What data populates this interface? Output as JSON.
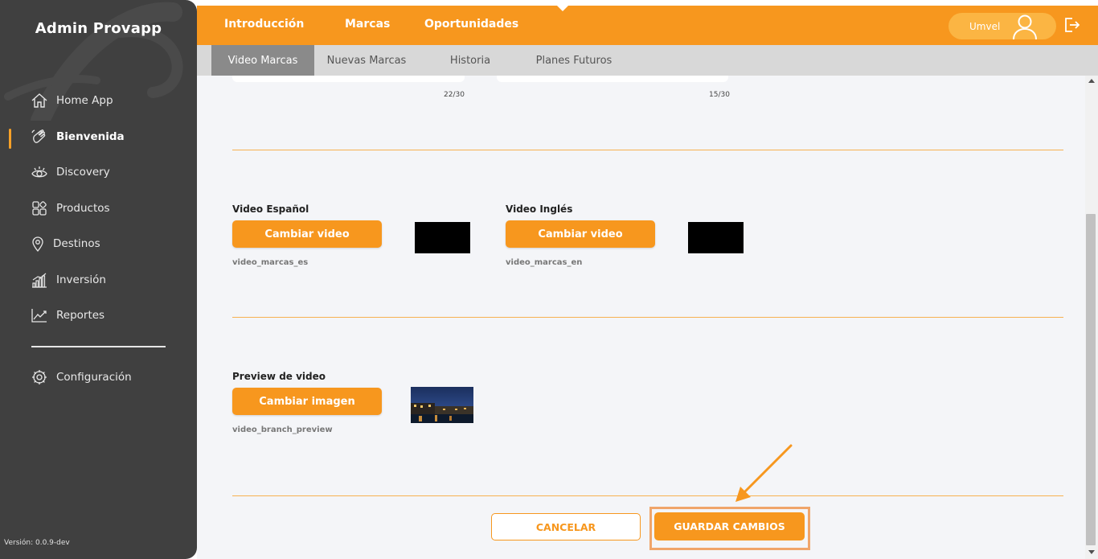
{
  "sidebar": {
    "title": "Admin Provapp",
    "items": [
      {
        "label": "Home App",
        "icon": "home-icon"
      },
      {
        "label": "Bienvenida",
        "icon": "waving-hand-icon",
        "active": true
      },
      {
        "label": "Discovery",
        "icon": "eye-icon"
      },
      {
        "label": "Productos",
        "icon": "grid-icon"
      },
      {
        "label": "Destinos",
        "icon": "map-pin-icon"
      },
      {
        "label": "Inversión",
        "icon": "bar-chart-icon"
      },
      {
        "label": "Reportes",
        "icon": "line-chart-icon"
      }
    ],
    "settings": {
      "label": "Configuración",
      "icon": "gear-icon"
    },
    "version": "Versión: 0.0.9-dev"
  },
  "topbar": {
    "tabs": [
      {
        "label": "Introducción"
      },
      {
        "label": "Marcas",
        "active": true
      },
      {
        "label": "Oportunidades"
      }
    ],
    "user": {
      "name": "Umvel",
      "icon": "user-icon"
    },
    "logout_icon": "logout-icon"
  },
  "subtabs": [
    {
      "label": "Video Marcas",
      "active": true
    },
    {
      "label": "Nuevas Marcas"
    },
    {
      "label": "Historia"
    },
    {
      "label": "Planes Futuros"
    }
  ],
  "main": {
    "counters": [
      "22/30",
      "15/30"
    ],
    "video_es": {
      "label": "Video Español",
      "button": "Cambiar video",
      "file": "video_marcas_es"
    },
    "video_en": {
      "label": "Video Inglés",
      "button": "Cambiar video",
      "file": "video_marcas_en"
    },
    "preview": {
      "label": "Preview de video",
      "button": "Cambiar imagen",
      "file": "video_branch_preview"
    },
    "actions": {
      "cancel": "CANCELAR",
      "save": "GUARDAR CAMBIOS"
    }
  },
  "colors": {
    "accent": "#f7971e",
    "sidebar": "#404040",
    "highlight": "#f0a56a"
  }
}
